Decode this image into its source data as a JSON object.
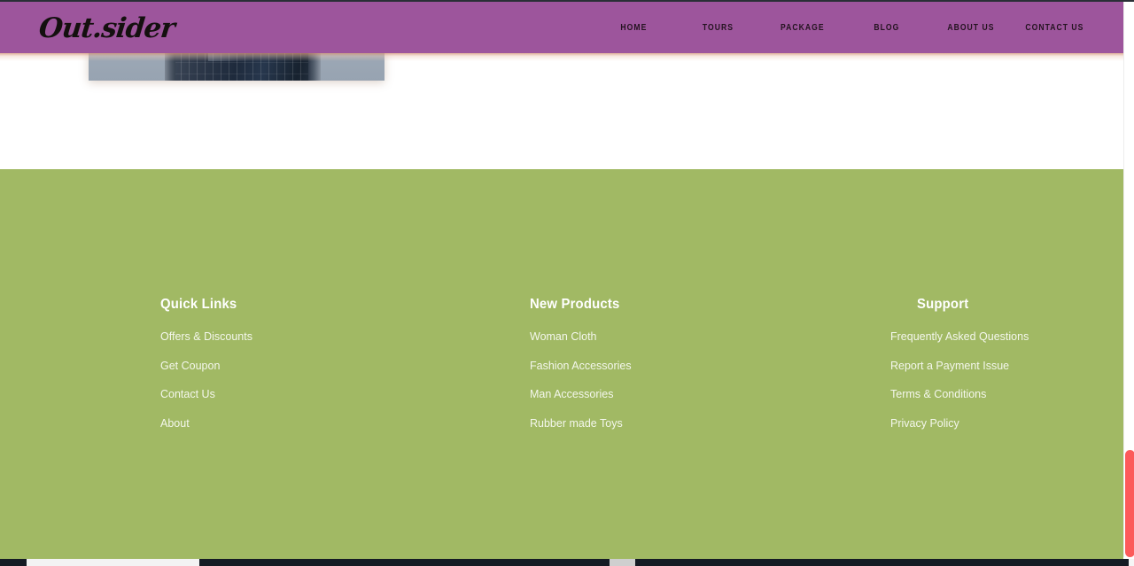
{
  "site": {
    "logo_text": "Out.sider"
  },
  "nav": {
    "items": [
      {
        "label": "HOME"
      },
      {
        "label": "TOURS"
      },
      {
        "label": "PACKAGE"
      },
      {
        "label": "BLOG"
      },
      {
        "label": "ABOUT US"
      },
      {
        "label": "CONTACT US"
      }
    ]
  },
  "hero": {
    "image_alt": "glass-skyscraper-photo"
  },
  "footer": {
    "columns": [
      {
        "title": "Quick Links",
        "links": [
          {
            "label": "Offers & Discounts"
          },
          {
            "label": "Get Coupon"
          },
          {
            "label": "Contact Us"
          },
          {
            "label": "About"
          }
        ]
      },
      {
        "title": "New Products",
        "links": [
          {
            "label": "Woman Cloth"
          },
          {
            "label": "Fashion Accessories"
          },
          {
            "label": "Man Accessories"
          },
          {
            "label": "Rubber made Toys"
          }
        ]
      },
      {
        "title": "Support",
        "links": [
          {
            "label": "Frequently Asked Questions"
          },
          {
            "label": "Report a Payment Issue"
          },
          {
            "label": "Terms & Conditions"
          },
          {
            "label": "Privacy Policy"
          }
        ]
      }
    ]
  },
  "colors": {
    "header_purple": "#9d559c",
    "footer_green": "#a1b964",
    "scrollbar_thumb": "#fc5a5a",
    "page_background": "#ffffff",
    "logo_text": "#14100f",
    "nav_text": "#241320",
    "footer_title": "#ffffff",
    "footer_link": "rgba(255,255,255,0.88)"
  },
  "scrollbar": {
    "thumb_label": "vertical-scroll-thumb"
  }
}
